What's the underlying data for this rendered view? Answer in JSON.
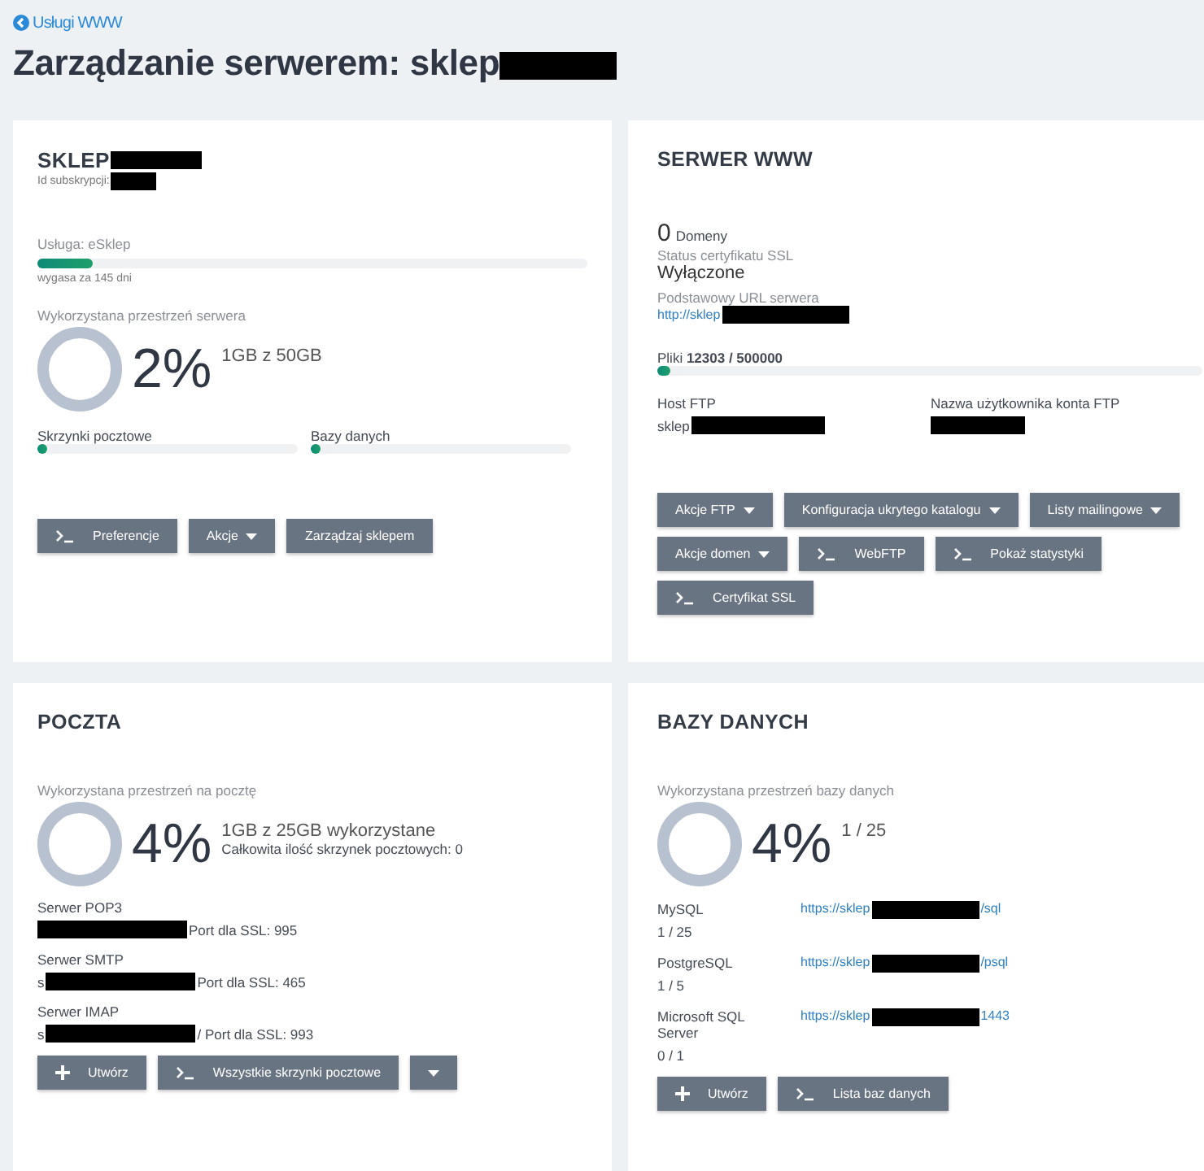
{
  "back_link": {
    "label": "Usługi WWW"
  },
  "title": {
    "text": "Zarządzanie serwerem: sklep",
    "redacted": true
  },
  "subscription": {
    "title": "SKLEP",
    "title_redacted": true,
    "id_label": "Id subskrypcji:",
    "id_redacted": true,
    "service": {
      "label": "Usługa: eSklep",
      "level": 0.1,
      "note": "wygasa za 145 dni"
    },
    "usage": {
      "label": "Wykorzystana przestrzeń serwera",
      "percent": "2%",
      "detail": "1GB z 50GB"
    },
    "meters": [
      {
        "label": "Skrzynki pocztowe",
        "level": 0.01
      },
      {
        "label": "Bazy danych",
        "level": 0.01
      }
    ],
    "buttons": [
      {
        "label": "Preferencje",
        "kind": "console",
        "dropdown": false
      },
      {
        "label": "Akcje",
        "kind": "plain",
        "dropdown": true
      },
      {
        "label": "Zarządzaj sklepem",
        "kind": "plain",
        "dropdown": false
      }
    ]
  },
  "web_server": {
    "title": "SERWER WWW",
    "domains_count": "0",
    "domains_label": "Domeny",
    "ssl_label": "Status certyfikatu SSL",
    "ssl_value": "Wyłączone",
    "url_label": "Podstawowy URL serwera",
    "url": {
      "text": "http://sklep",
      "redacted": true
    },
    "files": {
      "label": "Pliki",
      "value": "12303 / 500000",
      "level": 0.025
    },
    "ftp": [
      {
        "label": "Host FTP",
        "value": "sklep",
        "redacted": true
      },
      {
        "label": "Nazwa użytkownika konta FTP",
        "redacted": true
      }
    ],
    "buttons": [
      {
        "label": "Akcje FTP",
        "kind": "plain",
        "dropdown": true
      },
      {
        "label": "Konfiguracja ukrytego katalogu",
        "kind": "plain",
        "dropdown": true
      },
      {
        "label": "Listy mailingowe",
        "kind": "plain",
        "dropdown": true
      },
      {
        "label": "Akcje domen",
        "kind": "plain",
        "dropdown": true
      },
      {
        "label": "WebFTP",
        "kind": "console",
        "dropdown": false
      },
      {
        "label": "Pokaż statystyki",
        "kind": "console",
        "dropdown": false
      },
      {
        "label": "Certyfikat SSL",
        "kind": "console",
        "dropdown": false
      }
    ]
  },
  "mail": {
    "title": "POCZTA",
    "usage": {
      "label": "Wykorzystana przestrzeń na pocztę",
      "percent": "4%",
      "detail": "1GB z 25GB wykorzystane",
      "sub": "Całkowita ilość skrzynek pocztowych: 0"
    },
    "servers": [
      {
        "label": "Serwer POP3",
        "redacted": true,
        "suffix": "Port dla SSL: 995"
      },
      {
        "label": "Serwer SMTP",
        "prefix": "s",
        "redacted": true,
        "suffix": "Port dla SSL: 465"
      },
      {
        "label": "Serwer IMAP",
        "prefix": "s",
        "redacted": true,
        "suffix": "/ Port dla SSL: 993"
      }
    ],
    "buttons": [
      {
        "label": "Utwórz",
        "kind": "create",
        "dropdown": false
      },
      {
        "label": "Wszystkie skrzynki pocztowe",
        "kind": "console",
        "dropdown": false
      },
      {
        "kind": "plain",
        "dropdown": true
      }
    ]
  },
  "databases": {
    "title": "BAZY DANYCH",
    "usage": {
      "label": "Wykorzystana przestrzeń bazy danych",
      "percent": "4%",
      "detail": "1 / 25"
    },
    "engines": [
      {
        "name": "MySQL",
        "count": "1 / 25",
        "url_prefix": "https://sklep",
        "redacted": true,
        "url_suffix": "/sql"
      },
      {
        "name": "PostgreSQL",
        "count": "1 / 5",
        "url_prefix": "https://sklep",
        "redacted": true,
        "url_suffix": "/psql"
      },
      {
        "name": "Microsoft SQL Server",
        "count": "0 / 1",
        "url_prefix": "https://sklep",
        "redacted": true,
        "url_suffix": "1443"
      }
    ],
    "buttons": [
      {
        "label": "Utwórz",
        "kind": "create",
        "dropdown": false
      },
      {
        "label": "Lista baz danych",
        "kind": "console",
        "dropdown": false
      }
    ]
  }
}
